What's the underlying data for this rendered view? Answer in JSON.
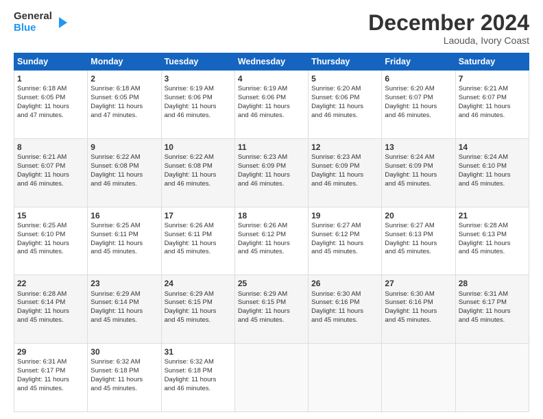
{
  "logo": {
    "line1": "General",
    "line2": "Blue"
  },
  "title": "December 2024",
  "location": "Laouda, Ivory Coast",
  "days_of_week": [
    "Sunday",
    "Monday",
    "Tuesday",
    "Wednesday",
    "Thursday",
    "Friday",
    "Saturday"
  ],
  "weeks": [
    [
      {
        "day": "1",
        "info": "Sunrise: 6:18 AM\nSunset: 6:05 PM\nDaylight: 11 hours\nand 47 minutes."
      },
      {
        "day": "2",
        "info": "Sunrise: 6:18 AM\nSunset: 6:05 PM\nDaylight: 11 hours\nand 47 minutes."
      },
      {
        "day": "3",
        "info": "Sunrise: 6:19 AM\nSunset: 6:06 PM\nDaylight: 11 hours\nand 46 minutes."
      },
      {
        "day": "4",
        "info": "Sunrise: 6:19 AM\nSunset: 6:06 PM\nDaylight: 11 hours\nand 46 minutes."
      },
      {
        "day": "5",
        "info": "Sunrise: 6:20 AM\nSunset: 6:06 PM\nDaylight: 11 hours\nand 46 minutes."
      },
      {
        "day": "6",
        "info": "Sunrise: 6:20 AM\nSunset: 6:07 PM\nDaylight: 11 hours\nand 46 minutes."
      },
      {
        "day": "7",
        "info": "Sunrise: 6:21 AM\nSunset: 6:07 PM\nDaylight: 11 hours\nand 46 minutes."
      }
    ],
    [
      {
        "day": "8",
        "info": "Sunrise: 6:21 AM\nSunset: 6:07 PM\nDaylight: 11 hours\nand 46 minutes."
      },
      {
        "day": "9",
        "info": "Sunrise: 6:22 AM\nSunset: 6:08 PM\nDaylight: 11 hours\nand 46 minutes."
      },
      {
        "day": "10",
        "info": "Sunrise: 6:22 AM\nSunset: 6:08 PM\nDaylight: 11 hours\nand 46 minutes."
      },
      {
        "day": "11",
        "info": "Sunrise: 6:23 AM\nSunset: 6:09 PM\nDaylight: 11 hours\nand 46 minutes."
      },
      {
        "day": "12",
        "info": "Sunrise: 6:23 AM\nSunset: 6:09 PM\nDaylight: 11 hours\nand 46 minutes."
      },
      {
        "day": "13",
        "info": "Sunrise: 6:24 AM\nSunset: 6:09 PM\nDaylight: 11 hours\nand 45 minutes."
      },
      {
        "day": "14",
        "info": "Sunrise: 6:24 AM\nSunset: 6:10 PM\nDaylight: 11 hours\nand 45 minutes."
      }
    ],
    [
      {
        "day": "15",
        "info": "Sunrise: 6:25 AM\nSunset: 6:10 PM\nDaylight: 11 hours\nand 45 minutes."
      },
      {
        "day": "16",
        "info": "Sunrise: 6:25 AM\nSunset: 6:11 PM\nDaylight: 11 hours\nand 45 minutes."
      },
      {
        "day": "17",
        "info": "Sunrise: 6:26 AM\nSunset: 6:11 PM\nDaylight: 11 hours\nand 45 minutes."
      },
      {
        "day": "18",
        "info": "Sunrise: 6:26 AM\nSunset: 6:12 PM\nDaylight: 11 hours\nand 45 minutes."
      },
      {
        "day": "19",
        "info": "Sunrise: 6:27 AM\nSunset: 6:12 PM\nDaylight: 11 hours\nand 45 minutes."
      },
      {
        "day": "20",
        "info": "Sunrise: 6:27 AM\nSunset: 6:13 PM\nDaylight: 11 hours\nand 45 minutes."
      },
      {
        "day": "21",
        "info": "Sunrise: 6:28 AM\nSunset: 6:13 PM\nDaylight: 11 hours\nand 45 minutes."
      }
    ],
    [
      {
        "day": "22",
        "info": "Sunrise: 6:28 AM\nSunset: 6:14 PM\nDaylight: 11 hours\nand 45 minutes."
      },
      {
        "day": "23",
        "info": "Sunrise: 6:29 AM\nSunset: 6:14 PM\nDaylight: 11 hours\nand 45 minutes."
      },
      {
        "day": "24",
        "info": "Sunrise: 6:29 AM\nSunset: 6:15 PM\nDaylight: 11 hours\nand 45 minutes."
      },
      {
        "day": "25",
        "info": "Sunrise: 6:29 AM\nSunset: 6:15 PM\nDaylight: 11 hours\nand 45 minutes."
      },
      {
        "day": "26",
        "info": "Sunrise: 6:30 AM\nSunset: 6:16 PM\nDaylight: 11 hours\nand 45 minutes."
      },
      {
        "day": "27",
        "info": "Sunrise: 6:30 AM\nSunset: 6:16 PM\nDaylight: 11 hours\nand 45 minutes."
      },
      {
        "day": "28",
        "info": "Sunrise: 6:31 AM\nSunset: 6:17 PM\nDaylight: 11 hours\nand 45 minutes."
      }
    ],
    [
      {
        "day": "29",
        "info": "Sunrise: 6:31 AM\nSunset: 6:17 PM\nDaylight: 11 hours\nand 45 minutes."
      },
      {
        "day": "30",
        "info": "Sunrise: 6:32 AM\nSunset: 6:18 PM\nDaylight: 11 hours\nand 45 minutes."
      },
      {
        "day": "31",
        "info": "Sunrise: 6:32 AM\nSunset: 6:18 PM\nDaylight: 11 hours\nand 46 minutes."
      },
      {
        "day": "",
        "info": ""
      },
      {
        "day": "",
        "info": ""
      },
      {
        "day": "",
        "info": ""
      },
      {
        "day": "",
        "info": ""
      }
    ]
  ]
}
